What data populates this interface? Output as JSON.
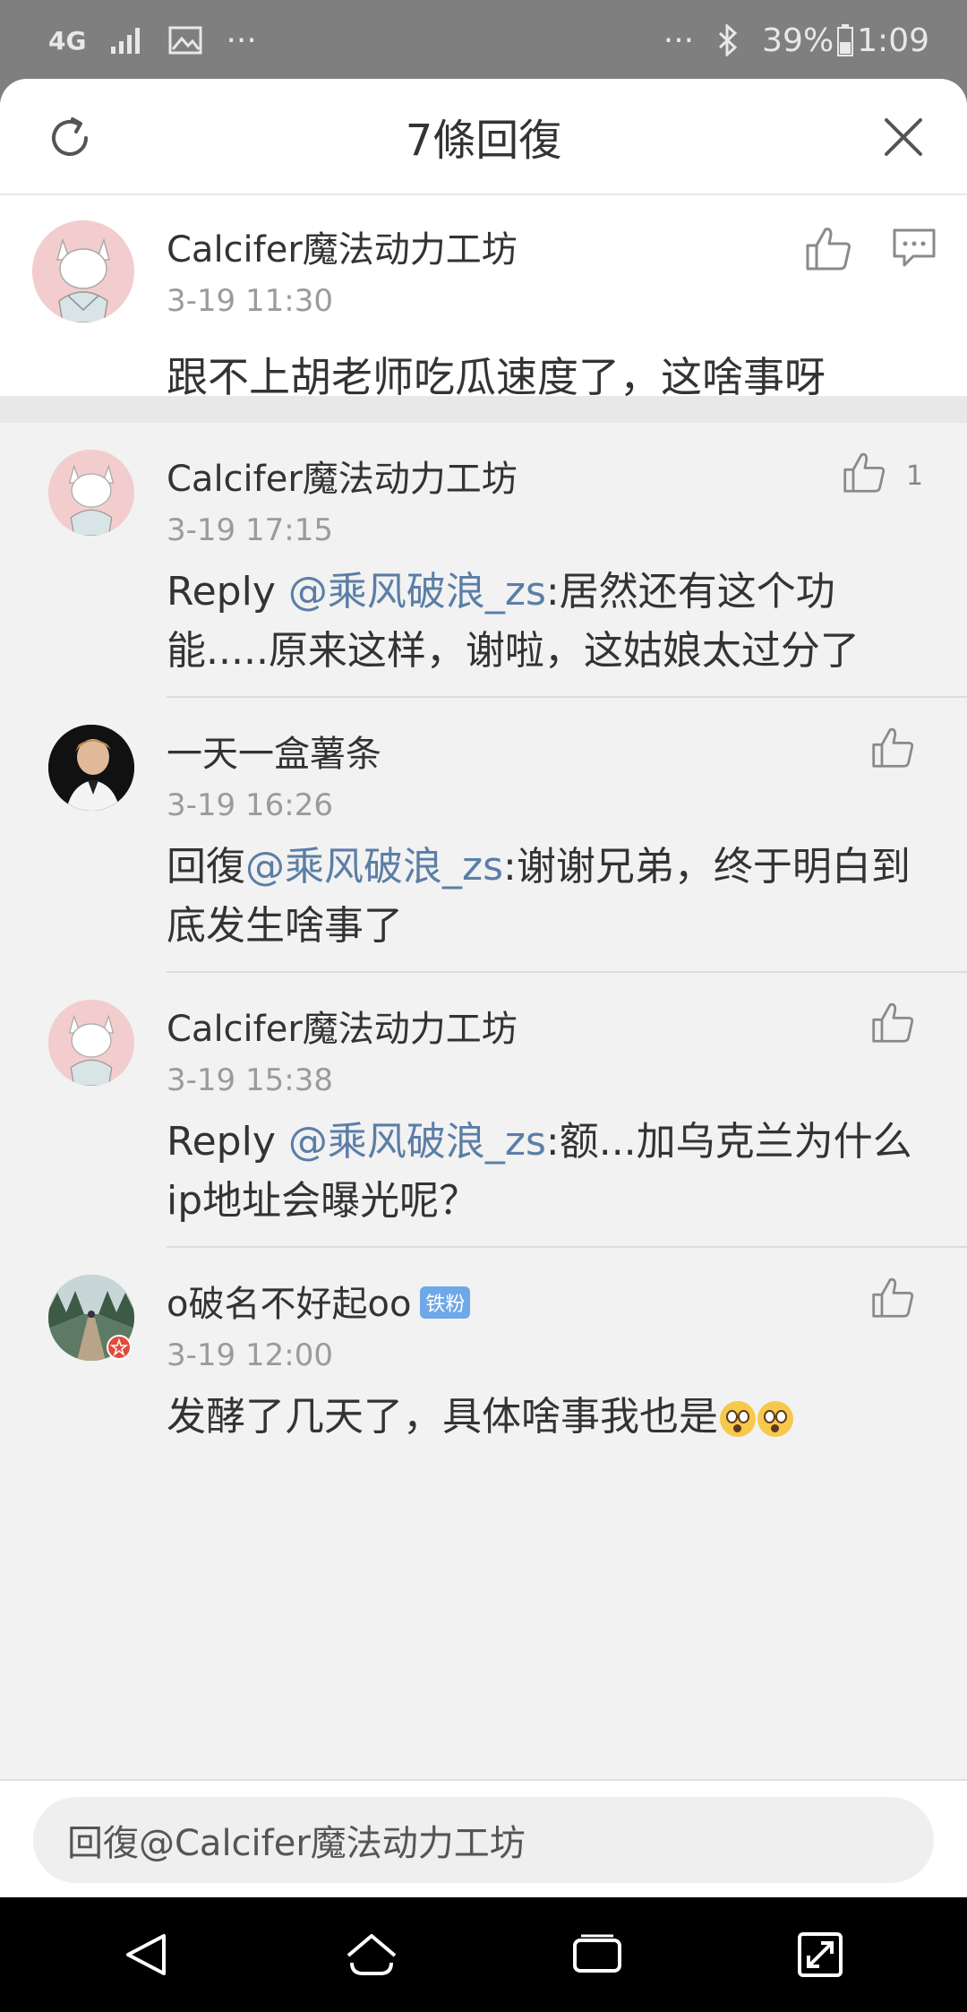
{
  "status_bar": {
    "network": "4G",
    "more_left": "···",
    "more_right": "···",
    "battery": "39%",
    "time": "1:09"
  },
  "sheet": {
    "title": "7條回復"
  },
  "main_comment": {
    "username": "Calcifer魔法动力工坊",
    "timestamp": "3-19 11:30",
    "text": "跟不上胡老师吃瓜速度了，这啥事呀"
  },
  "replies": [
    {
      "username": "Calcifer魔法动力工坊",
      "timestamp": "3-19 17:15",
      "prefix": "Reply ",
      "mention": "@乘风破浪_zs",
      "text": ":居然还有这个功能.....原来这样，谢啦，这姑娘太过分了",
      "likes": "1"
    },
    {
      "username": "一天一盒薯条",
      "timestamp": "3-19 16:26",
      "prefix": "回復",
      "mention": "@乘风破浪_zs",
      "text": ":谢谢兄弟，终于明白到底发生啥事了"
    },
    {
      "username": "Calcifer魔法动力工坊",
      "timestamp": "3-19 15:38",
      "prefix": "Reply ",
      "mention": "@乘风破浪_zs",
      "text": ":额...加乌克兰为什么ip地址会曝光呢？"
    },
    {
      "username": "o破名不好起oo",
      "badge": "铁粉",
      "timestamp": "3-19 12:00",
      "text": "发酵了几天了，具体啥事我也是"
    }
  ],
  "input": {
    "placeholder": "回復@Calcifer魔法动力工坊"
  }
}
